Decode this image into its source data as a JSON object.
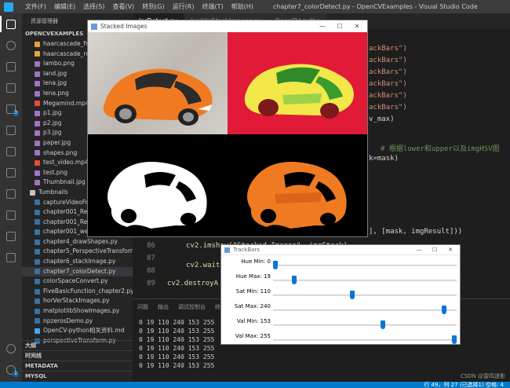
{
  "titlebar": {
    "menu": [
      "文件(F)",
      "编辑(E)",
      "选择(S)",
      "查看(V)",
      "转到(G)",
      "运行(R)",
      "终端(T)",
      "帮助(H)"
    ],
    "title": "chapter7_colorDetect.py - OpenCVExamples - Visual Studio Code"
  },
  "activity_bar": {
    "badges": [
      "3",
      "1"
    ]
  },
  "explorer": {
    "header": "资源管理器",
    "project": "OPENCVEXAMPLES",
    "files": [
      {
        "name": "haarcascade_frontal",
        "color": "#e8a33d"
      },
      {
        "name": "haarcascade_russia",
        "color": "#e8a33d"
      },
      {
        "name": "lambo.png",
        "color": "#a074c4"
      },
      {
        "name": "land.jpg",
        "color": "#a074c4"
      },
      {
        "name": "lena.jpg",
        "color": "#a074c4"
      },
      {
        "name": "lena.png",
        "color": "#a074c4"
      },
      {
        "name": "Megamind.mp4",
        "color": "#e54d3a"
      },
      {
        "name": "p1.jpg",
        "color": "#a074c4"
      },
      {
        "name": "p2.jpg",
        "color": "#a074c4"
      },
      {
        "name": "p3.jpg",
        "color": "#a074c4"
      },
      {
        "name": "paper.jpg",
        "color": "#a074c4"
      },
      {
        "name": "shapes.png",
        "color": "#a074c4"
      },
      {
        "name": "test_video.mp4",
        "color": "#e54d3a"
      },
      {
        "name": "test.png",
        "color": "#a074c4"
      },
      {
        "name": "Thumbnail.jpg",
        "color": "#a074c4"
      },
      {
        "name": "Tumbnails",
        "color": "#c5c5c5"
      },
      {
        "name": "captureVideoFromCamera.py",
        "color": "#3572a5"
      },
      {
        "name": "chapter001_ReadImage.py",
        "color": "#3572a5"
      },
      {
        "name": "chapter001_ReadVideo.py",
        "color": "#3572a5"
      },
      {
        "name": "chapter001_webcam.py",
        "color": "#3572a5"
      },
      {
        "name": "chapter4_drawShapes.py",
        "color": "#3572a5"
      },
      {
        "name": "chapter5_PerspectiveTransform.py",
        "color": "#3572a5"
      },
      {
        "name": "chapter6_stackImage.py",
        "color": "#3572a5"
      },
      {
        "name": "chapter7_colorDetect.py",
        "color": "#3572a5"
      },
      {
        "name": "colorSpaceConvert.py",
        "color": "#3572a5"
      },
      {
        "name": "FiveBasicFunction_chapter2.py",
        "color": "#3572a5"
      },
      {
        "name": "horVerStackImages.py",
        "color": "#3572a5"
      },
      {
        "name": "matplotlibShowImages.py",
        "color": "#3572a5"
      },
      {
        "name": "npzerosDemo.py",
        "color": "#3572a5"
      },
      {
        "name": "OpenCV-python相关资料.md",
        "color": "#42a5f5"
      },
      {
        "name": "perspectiveTransform.py",
        "color": "#3572a5"
      }
    ],
    "selected_index": 23,
    "sections": [
      "大纲",
      "时间线",
      "METADATA",
      "MYSQL"
    ]
  },
  "editor": {
    "tabs": [
      "lorDetect.py",
      "horVerStackImages.py",
      "OpenCV-pytho"
    ],
    "right_code": [
      "ackBars\")",
      "ackBars\")",
      "ackBars\")",
      "ackBars\")",
      "ackBars\")",
      "ackBars\")",
      "v_max)"
    ],
    "comment": "# 根据lower和upper以及imgHSV图",
    "mask_line": "k=mask)",
    "stack_line": "], [mask, imgResult]))",
    "line_86": "86",
    "line_86_code": "cv2.imshow(\"Stacked Images\", imgStack)",
    "line_87": "87",
    "line_87_code": "cv2.waitK",
    "line_88": "88",
    "line_89": "89",
    "line_89_code": "cv2.destroyA"
  },
  "panel": {
    "tabs": [
      "问题",
      "输出",
      "调试控制台",
      "终端"
    ],
    "terminal_lines": [
      "0 19 110 240 153 255",
      "0 19 110 240 153 255",
      "0 19 110 240 153 255",
      "0 19 110 240 153 255",
      "0 19 110 240 153 255",
      "0 19 110 240 153 255"
    ]
  },
  "statusbar": {
    "text": "行 49，列 27 (已选择1)    空格: 4"
  },
  "stacked_window": {
    "title": "Stacked Images"
  },
  "trackbars_window": {
    "title": "TrackBars",
    "trackbars": [
      {
        "label": "Hue Min: 0",
        "value": 0,
        "max": 179
      },
      {
        "label": "Hue Max: 19",
        "value": 19,
        "max": 179
      },
      {
        "label": "Sat Min: 110",
        "value": 110,
        "max": 255
      },
      {
        "label": "Sat Max: 240",
        "value": 240,
        "max": 255
      },
      {
        "label": "Val Min: 153",
        "value": 153,
        "max": 255
      },
      {
        "label": "Val Max: 255",
        "value": 255,
        "max": 255
      }
    ]
  },
  "watermark": "CSDN @雷鸣迷影"
}
